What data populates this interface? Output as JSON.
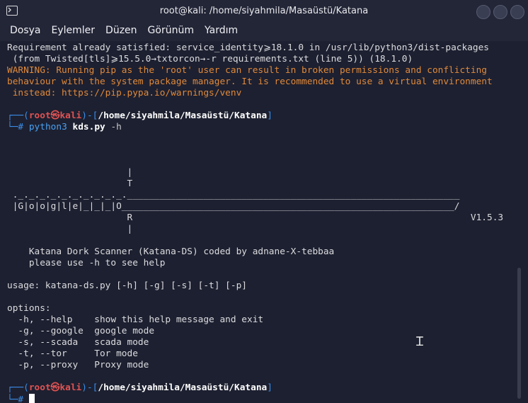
{
  "window": {
    "title": "root@kali: /home/siyahmila/Masaüstü/Katana"
  },
  "menu": [
    "Dosya",
    "Eylemler",
    "Düzen",
    "Görünüm",
    "Yardım"
  ],
  "terminal": {
    "req_line1": "Requirement already satisfied: service_identity⩾18.1.0 in /usr/lib/python3/dist-packages",
    "req_line2": " (from Twisted[tls]⩾15.5.0→txtorcon→-r requirements.txt (line 5)) (18.1.0)",
    "warn1": "WARNING: Running pip as the 'root' user can result in broken permissions and conflicting",
    "warn2": "behaviour with the system package manager. It is recommended to use a virtual environment",
    "warn3": " instead: https://pip.pypa.io/warnings/venv",
    "prompt1": {
      "prefix": "┌──(",
      "user": "root㉿kali",
      "mid": ")-[",
      "path": "/home/siyahmila/Masaüstü/Katana",
      "end": "]",
      "line2": "└─#",
      "cmd": "python3",
      "arg": "kds.py",
      "flag": "-h"
    },
    "banner": [
      "                      |",
      "                      T",
      " ._._._._._._._._._._._____________________________________________________________",
      " |G|o|o|g|l|e|_|_|_|O_____________________________________________________________/",
      "                      R                                                              V1.5.3",
      "                      |"
    ],
    "desc1": "    Katana Dork Scanner (Katana-DS) coded by adnane-X-tebbaa",
    "desc2": "    please use -h to see help",
    "usage": "usage: katana-ds.py [-h] [-g] [-s] [-t] [-p]",
    "options_header": "options:",
    "options": [
      "  -h, --help    show this help message and exit",
      "  -g, --google  google mode",
      "  -s, --scada   scada mode",
      "  -t, --tor     Tor mode",
      "  -p, --proxy   Proxy mode"
    ],
    "prompt2": {
      "prefix": "┌──(",
      "user": "root㉿kali",
      "mid": ")-[",
      "path": "/home/siyahmila/Masaüstü/Katana",
      "end": "]",
      "line2": "└─#"
    }
  }
}
